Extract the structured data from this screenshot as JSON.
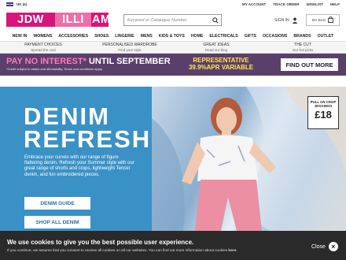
{
  "util": {
    "region": "UK (£)",
    "links": [
      "MY ACCOUNT",
      "TRACK ORDER",
      "WISHLIST",
      "HELP"
    ]
  },
  "header": {
    "logo": {
      "part1": "JDW",
      "part2": "ILLI",
      "part3": "AMS"
    },
    "search_placeholder": "Keyword or Catalogue Number",
    "signin": "SIGN IN",
    "bag": "MY BAG"
  },
  "nav": [
    "NEW IN",
    "WOMENS",
    "ACCESSORIES",
    "SHOES",
    "LINGERIE",
    "MENS",
    "KIDS & TOYS",
    "HOME",
    "ELECTRICALS",
    "GIFTS",
    "OCCASIONS",
    "BRANDS",
    "OUTLET"
  ],
  "promos": [
    {
      "title": "PAYMENT CHOICES",
      "sub": "Spread the cost"
    },
    {
      "title": "PERSONALISED WARDROBE",
      "sub": "Find your style"
    },
    {
      "title": "GREAT IDEAS",
      "sub": "Read our blog"
    },
    {
      "title": "THE CUT",
      "sub": "Our hot picks"
    }
  ],
  "banner": {
    "highlight": "PAY NO INTEREST*",
    "rest": " UNTIL SEPTEMBER",
    "sub": "*Credit subject to status and affordability. Terms and conditions apply.",
    "rep1": "REPRESENTATIVE",
    "rep2": "39.9%APR VARIABLE",
    "cta": "FIND OUT MORE"
  },
  "hero": {
    "title1": "DENIM",
    "title2": "REFRESH",
    "text": "Embrace your curves with our range of figure flattering denim. Refresh your Summer style with our great range of shorts and crops, lightweight Tencel denim, and fun embroidered pieces.",
    "btn_guide": "DENIM GUIDE",
    "btn_shop": "SHOP ALL DENIM",
    "tag_title": "PULL ON CROP JEGGINGS",
    "tag_price": "£18"
  },
  "cookie": {
    "title": "We use cookies to give you the best possible user experience.",
    "text_start": "If you continue, we assume that you consent to receive all cookies on all our websites. You can find out more information about cookies ",
    "text_link": "here",
    "close": "Close"
  },
  "colors": {
    "brand_pink": "#d6157a",
    "banner_purple": "#5b3f6b",
    "hero_blue": "#3a91c6",
    "rep_yellow": "#ffe94a"
  }
}
